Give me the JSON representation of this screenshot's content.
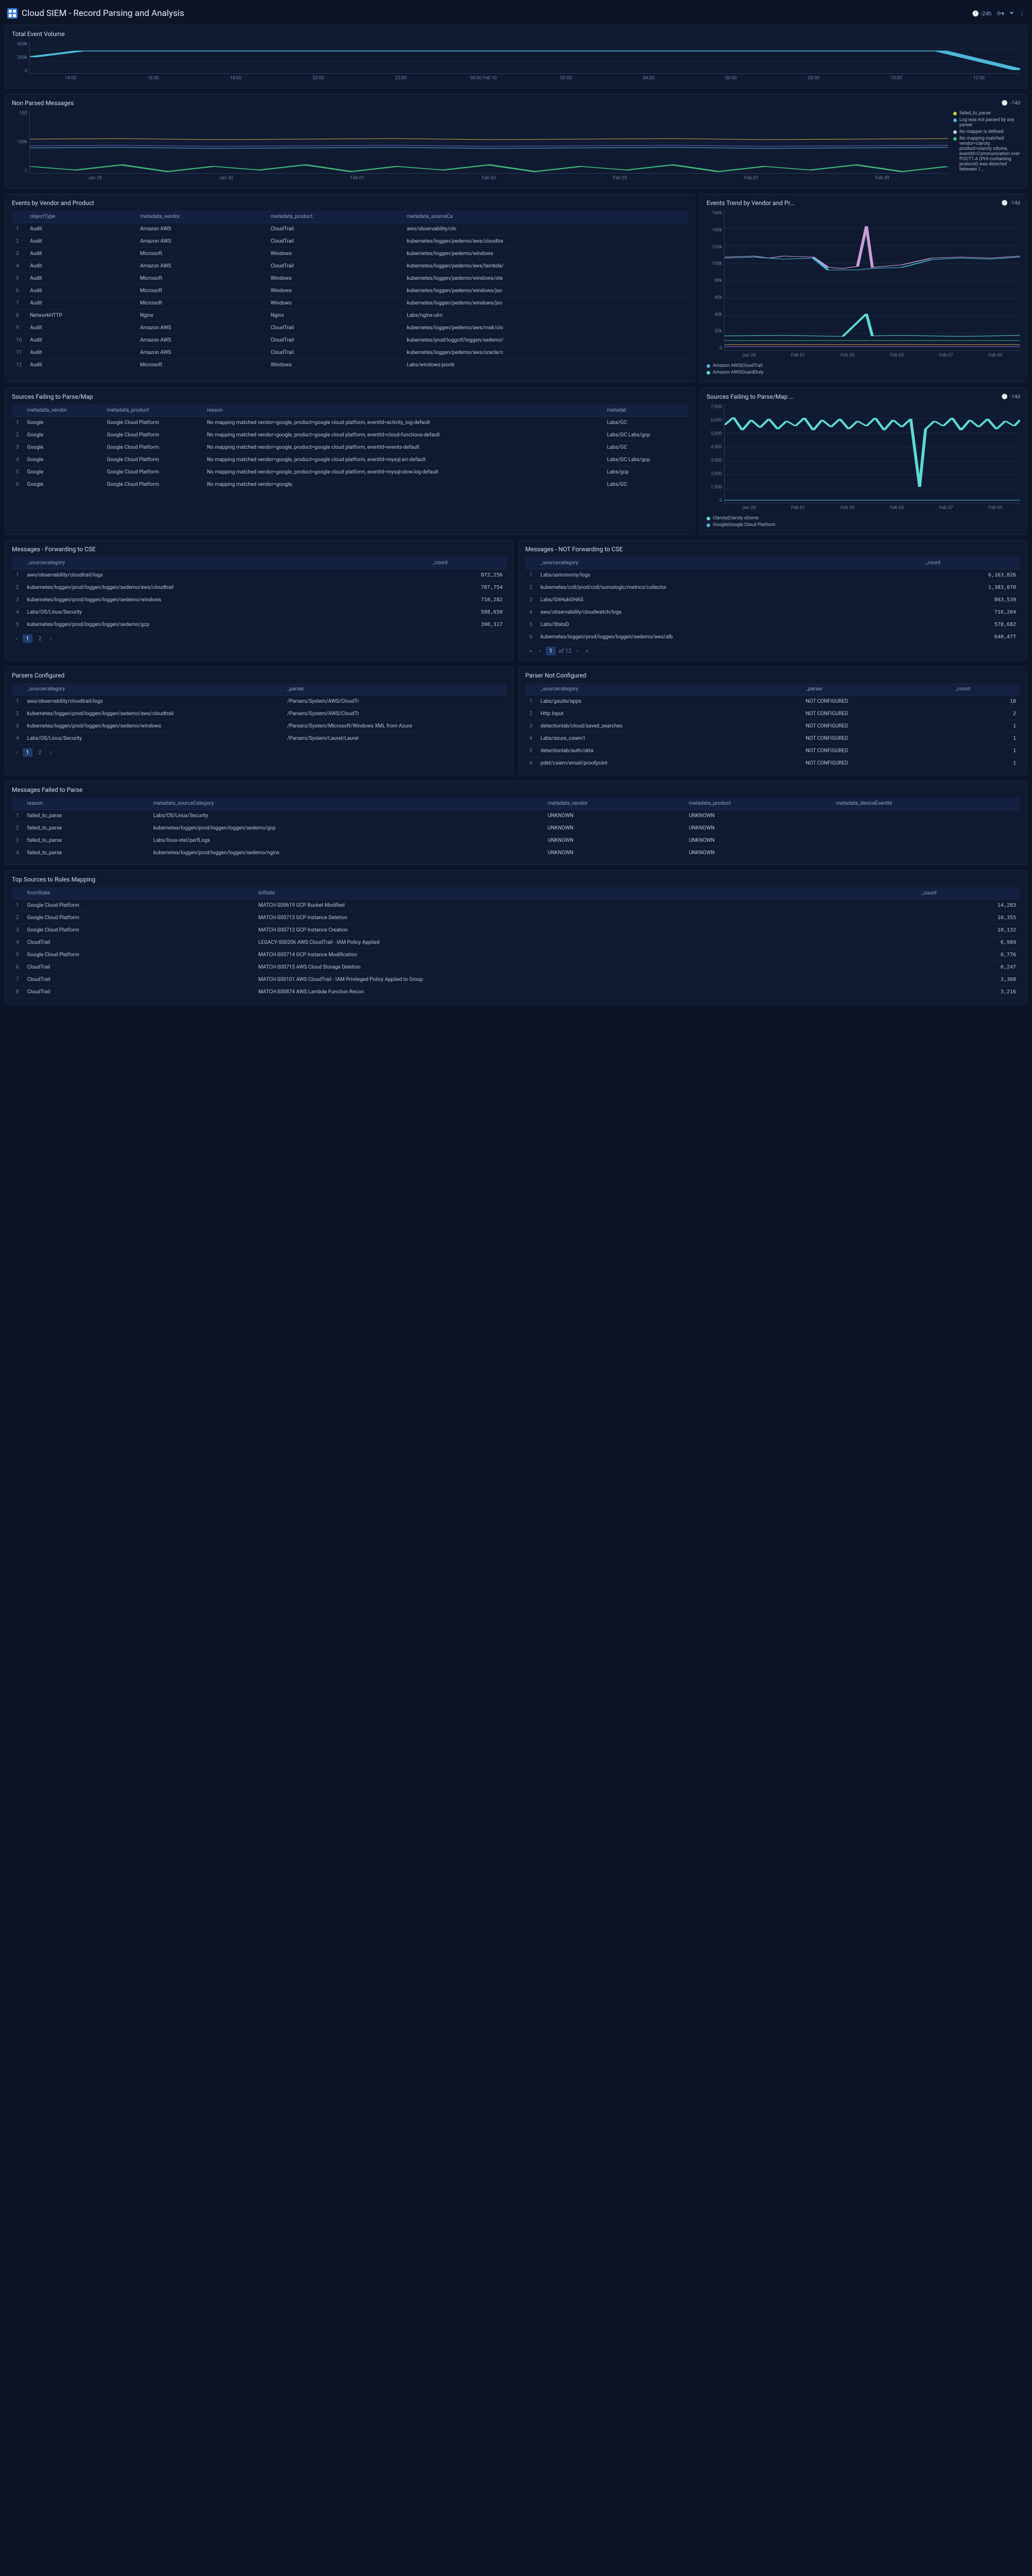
{
  "header": {
    "title": "Cloud SIEM - Record Parsing and Analysis",
    "time_range": "-24h"
  },
  "panels": {
    "total_event_volume": {
      "title": "Total Event Volume",
      "y_ticks": [
        "400k",
        "200k",
        "0"
      ],
      "x_ticks": [
        "14:00",
        "16:00",
        "18:00",
        "20:00",
        "22:00",
        "00:00 Feb 10",
        "02:00",
        "04:00",
        "06:00",
        "08:00",
        "10:00",
        "12:00"
      ]
    },
    "non_parsed": {
      "title": "Non Parsed Messages",
      "time": "-14d",
      "y_ticks": [
        "10G",
        "100k",
        "1"
      ],
      "x_ticks": [
        "Jan 28",
        "Jan 30",
        "Feb 01",
        "Feb 03",
        "Feb 05",
        "Feb 07",
        "Feb 09"
      ],
      "legend": [
        {
          "color": "#b8d94a",
          "label": "failed_to_parse"
        },
        {
          "color": "#4db8d9",
          "label": "Log was not parsed by any parser"
        },
        {
          "color": "#c3cce0",
          "label": "No mapper is defined"
        },
        {
          "color": "#3fb87a",
          "label": "No mapping matched vendor=claroty, product=claroty xdome, eventId=Communication over POCT1-A (PHI-containing protocol) was detected between 1..."
        }
      ]
    },
    "events_by_vendor": {
      "title": "Events by Vendor and Product",
      "cols": [
        "objectType",
        "metadata_vendor",
        "metadata_product",
        "metadata_sourceCa"
      ],
      "rows": [
        [
          "1",
          "Audit",
          "Amazon AWS",
          "CloudTrail",
          "aws/observability/clo"
        ],
        [
          "2",
          "Audit",
          "Amazon AWS",
          "CloudTrail",
          "kubernetes/loggen/pedemo/aws/cloudtra"
        ],
        [
          "3",
          "Audit",
          "Microsoft",
          "Windows",
          "kubernetes/loggen/pedemo/windows"
        ],
        [
          "4",
          "Audit",
          "Amazon AWS",
          "CloudTrail",
          "kubernetes/loggen/pedemo/aws/lambda/"
        ],
        [
          "5",
          "Audit",
          "Microsoft",
          "Windows",
          "kubernetes/loggen/pedemo/windows/ote"
        ],
        [
          "6",
          "Audit",
          "Microsoft",
          "Windows",
          "kubernetes/loggen/pedemo/windows/jso"
        ],
        [
          "7",
          "Audit",
          "Microsoft",
          "Windows",
          "kubernetes/loggen/pedemo/windows/jso"
        ],
        [
          "8",
          "NetworkHTTP",
          "Nginx",
          "Nginx",
          "Labs/nginx-ulm"
        ],
        [
          "9",
          "Audit",
          "Amazon AWS",
          "CloudTrail",
          "kubernetes/loggen/pedemo/aws/msk/clo"
        ],
        [
          "10",
          "Audit",
          "Amazon AWS",
          "CloudTrail",
          "kubernetes/prod/loggctf/loggen/sedemo/"
        ],
        [
          "11",
          "Audit",
          "Amazon AWS",
          "CloudTrail",
          "kubernetes/loggen/pedemo/aws/oracle/c"
        ],
        [
          "12",
          "Audit",
          "Microsoft",
          "Windows",
          "Labs/windows-jsonb"
        ]
      ]
    },
    "events_trend": {
      "title": "Events Trend by Vendor and Pr...",
      "time": "-14d",
      "y_ticks": [
        "160k",
        "140k",
        "120k",
        "100k",
        "80k",
        "60k",
        "40k",
        "20k",
        "0"
      ],
      "x_ticks": [
        "Jan 28",
        "Feb 01",
        "Feb 03",
        "Feb 05",
        "Feb 07",
        "Feb 09"
      ],
      "legend": [
        {
          "color": "#4db8d9",
          "label": "Amazon AWS|CloudTrail"
        },
        {
          "color": "#5ed9d4",
          "label": "Amazon AWS|GuardDuty"
        }
      ]
    },
    "sources_failing": {
      "title": "Sources Failing to Parse/Map",
      "cols": [
        "metadata_vendor",
        "metadata_product",
        "reason",
        "metadat"
      ],
      "rows": [
        [
          "1",
          "Google",
          "Google Cloud Platform",
          "No mapping matched vendor=google, product=google cloud platform, eventId=activity_log-default",
          "Labs/GC"
        ],
        [
          "2",
          "Google",
          "Google Cloud Platform",
          "No mapping matched vendor=google, product=google cloud platform, eventId=cloud-functions-default",
          "Labs/GC Labs/gcp"
        ],
        [
          "3",
          "Google",
          "Google Cloud Platform",
          "No mapping matched vendor=google, product=google cloud platform, eventId=events-default",
          "Labs/GC"
        ],
        [
          "4",
          "Google",
          "Google Cloud Platform",
          "No mapping matched vendor=google, product=google cloud platform, eventId=mysql.err-default",
          "Labs/GC Labs/gcp"
        ],
        [
          "5",
          "Google",
          "Google Cloud Platform",
          "No mapping matched vendor=google, product=google cloud platform, eventId=mysql-slow.log-default",
          "Labs/gcp"
        ],
        [
          "6",
          "Google",
          "Google Cloud Platform",
          "No mapping matched vendor=google,",
          "Labs/GC"
        ]
      ]
    },
    "sources_failing_trend": {
      "title": "Sources Failing to Parse/Map ...",
      "time": "-14d",
      "y_ticks": [
        "7,000",
        "6,000",
        "5,000",
        "4,000",
        "3,000",
        "2,000",
        "1,000",
        "0"
      ],
      "x_ticks": [
        "Jan 28",
        "Feb 01",
        "Feb 03",
        "Feb 05",
        "Feb 07",
        "Feb 09"
      ],
      "legend": [
        {
          "color": "#5ed9d4",
          "label": "Claroty|Claroty xDome"
        },
        {
          "color": "#4db8d9",
          "label": "Google|Google Cloud Platform"
        }
      ]
    },
    "msgs_fwd": {
      "title": "Messages - Forwarding to CSE",
      "cols": [
        "_sourcecategory",
        "_count"
      ],
      "rows": [
        [
          "1",
          "aws/observability/cloudtrail/logs",
          "872,256"
        ],
        [
          "2",
          "kubernetes/loggen/prod/loggen/loggen/sedemo/aws/cloudtrail",
          "787,754"
        ],
        [
          "3",
          "kubernetes/loggen/prod/loggen/loggen/sedemo/windows",
          "710,282"
        ],
        [
          "4",
          "Labs/OS/Linux/Security",
          "588,650"
        ],
        [
          "5",
          "kubernetes/loggen/prod/loggen/loggen/sedemo/gcp",
          "390,317"
        ]
      ],
      "pager": [
        "1",
        "2"
      ]
    },
    "msgs_not_fwd": {
      "title": "Messages - NOT Forwarding to CSE",
      "cols": [
        "_sourcecategory",
        "_count"
      ],
      "rows": [
        [
          "1",
          "Labs/astronomy/logs",
          "6,163,826"
        ],
        [
          "2",
          "kubernetes/coll/prod/coll/sumologic/metrics/collector",
          "1,383,070"
        ],
        [
          "3",
          "Labs/GitHubGHAS",
          "863,539"
        ],
        [
          "4",
          "aws/observability/cloudwatch/logs",
          "716,264"
        ],
        [
          "5",
          "Labs/StatsD",
          "578,682"
        ],
        [
          "6",
          "kubernetes/loggen/prod/loggen/loggen/sedemo/aws/alb",
          "640,477"
        ]
      ],
      "pager_text": "of 12"
    },
    "parsers_cfg": {
      "title": "Parsers Configured",
      "cols": [
        "_sourcecategory",
        "_parser"
      ],
      "rows": [
        [
          "1",
          "aws/observability/cloudtrail/logs",
          "/Parsers/System/AWS/CloudTr"
        ],
        [
          "2",
          "kubernetes/loggen/prod/loggen/loggen/sedemo/aws/cloudtrail",
          "/Parsers/System/AWS/CloudTr"
        ],
        [
          "3",
          "kubernetes/loggen/prod/loggen/loggen/sedemo/windows",
          "/Parsers/System/Microsoft/Windows XML from Azure"
        ],
        [
          "4",
          "Labs/OS/Linux/Security",
          "/Parsers/System/Laurel/Laurel"
        ]
      ],
      "pager": [
        "1",
        "2"
      ]
    },
    "parser_not_cfg": {
      "title": "Parser Not Configured",
      "cols": [
        "_sourcecategory",
        "_parser",
        "_count"
      ],
      "rows": [
        [
          "1",
          "Labs/gsuite/apps",
          "NOT CONFIGURED",
          "18"
        ],
        [
          "2",
          "Http Input",
          "NOT CONFIGURED",
          "2"
        ],
        [
          "3",
          "detectionlab/cloud/saved_searches",
          "NOT CONFIGURED",
          "1"
        ],
        [
          "4",
          "Labs/azure_csiem1",
          "NOT CONFIGURED",
          "1"
        ],
        [
          "5",
          "detectionlab/auth/okta",
          "NOT CONFIGURED",
          "1"
        ],
        [
          "6",
          "pdet/csiem/email/proofpoint",
          "NOT CONFIGURED",
          "1"
        ]
      ]
    },
    "msgs_failed": {
      "title": "Messages Failed to Parse",
      "cols": [
        "reason",
        "metadata_sourceCategory",
        "metadata_vendor",
        "metadata_product",
        "metadata_deviceEventId"
      ],
      "rows": [
        [
          "1",
          "failed_to_parse",
          "Labs/OS/Linux/Security",
          "UNKNOWN",
          "UNKNOWN",
          ""
        ],
        [
          "2",
          "failed_to_parse",
          "kubernetes/loggen/prod/loggen/loggen/sedemo/gcp",
          "UNKNOWN",
          "UNKNOWN",
          ""
        ],
        [
          "3",
          "failed_to_parse",
          "Labs/linux-otel/perfLogs",
          "UNKNOWN",
          "UNKNOWN",
          ""
        ],
        [
          "4",
          "failed_to_parse",
          "kubernetes/loggen/prod/loggen/loggen/sedemo/nginx",
          "UNKNOWN",
          "UNKNOWN",
          ""
        ]
      ]
    },
    "top_sources": {
      "title": "Top Sources to Rules Mapping",
      "cols": [
        "fromState",
        "toState",
        "_count"
      ],
      "rows": [
        [
          "1",
          "Google Cloud Platform",
          "MATCH-S00619 GCP Bucket Modified",
          "14,283"
        ],
        [
          "2",
          "Google Cloud Platform",
          "MATCH-S00713 GCP Instance Deletion",
          "10,355"
        ],
        [
          "3",
          "Google Cloud Platform",
          "MATCH-S00712 GCP Instance Creation",
          "10,132"
        ],
        [
          "4",
          "CloudTrail",
          "LEGACY-S00206 AWS CloudTrail - IAM Policy Applied",
          "6,989"
        ],
        [
          "5",
          "Google Cloud Platform",
          "MATCH-S00714 GCP Instance Modification",
          "6,776"
        ],
        [
          "6",
          "CloudTrail",
          "MATCH-S00715 AWS Cloud Storage Deletion",
          "6,247"
        ],
        [
          "7",
          "CloudTrail",
          "MATCH-S00101 AWS CloudTrail - IAM Privileged Policy Applied to Group",
          "3,368"
        ],
        [
          "8",
          "CloudTrail",
          "MATCH-S00874 AWS Lambda Function Recon",
          "3,216"
        ]
      ]
    }
  },
  "chart_data": [
    {
      "type": "line",
      "title": "Total Event Volume",
      "x": [
        "14:00",
        "16:00",
        "18:00",
        "20:00",
        "22:00",
        "00:00",
        "02:00",
        "04:00",
        "06:00",
        "08:00",
        "10:00",
        "12:00",
        "13:00"
      ],
      "values": [
        260000,
        300000,
        300000,
        300000,
        300000,
        300000,
        300000,
        300000,
        300000,
        300000,
        300000,
        300000,
        40000
      ],
      "ylim": [
        0,
        400000
      ]
    },
    {
      "type": "line",
      "title": "Non Parsed Messages",
      "x": [
        "Jan 28",
        "Jan 30",
        "Feb 01",
        "Feb 03",
        "Feb 05",
        "Feb 07",
        "Feb 09"
      ],
      "series": [
        {
          "name": "failed_to_parse",
          "values": [
            80000,
            80000,
            80000,
            80000,
            80000,
            80000,
            80000
          ]
        },
        {
          "name": "Log was not parsed by any parser",
          "values": [
            60000,
            60000,
            60000,
            60000,
            60000,
            60000,
            60000
          ]
        },
        {
          "name": "No mapper is defined",
          "values": [
            50000,
            50000,
            50000,
            50000,
            50000,
            50000,
            50000
          ]
        },
        {
          "name": "No mapping matched vendor=claroty",
          "values": [
            3,
            3,
            3,
            3,
            3,
            3,
            3
          ]
        }
      ],
      "ylim": [
        1,
        10000000000
      ],
      "yscale": "log"
    },
    {
      "type": "line",
      "title": "Events Trend by Vendor and Product",
      "x": [
        "Jan 28",
        "Feb 01",
        "Feb 03",
        "Feb 05",
        "Feb 07",
        "Feb 09"
      ],
      "series": [
        {
          "name": "Amazon AWS|CloudTrail",
          "values": [
            108000,
            108000,
            95000,
            95000,
            100000,
            100000
          ]
        },
        {
          "name": "Amazon AWS|GuardDuty",
          "values": [
            15000,
            15000,
            15000,
            15000,
            15000,
            15000
          ]
        }
      ],
      "ylim": [
        0,
        160000
      ]
    },
    {
      "type": "line",
      "title": "Sources Failing to Parse/Map",
      "x": [
        "Jan 28",
        "Feb 01",
        "Feb 03",
        "Feb 05",
        "Feb 07",
        "Feb 09"
      ],
      "series": [
        {
          "name": "Claroty|Claroty xDome",
          "values": [
            5500,
            5800,
            5600,
            5700,
            5500,
            5600
          ]
        },
        {
          "name": "Google|Google Cloud Platform",
          "values": [
            200,
            200,
            200,
            200,
            200,
            200
          ]
        }
      ],
      "ylim": [
        0,
        7000
      ]
    }
  ]
}
